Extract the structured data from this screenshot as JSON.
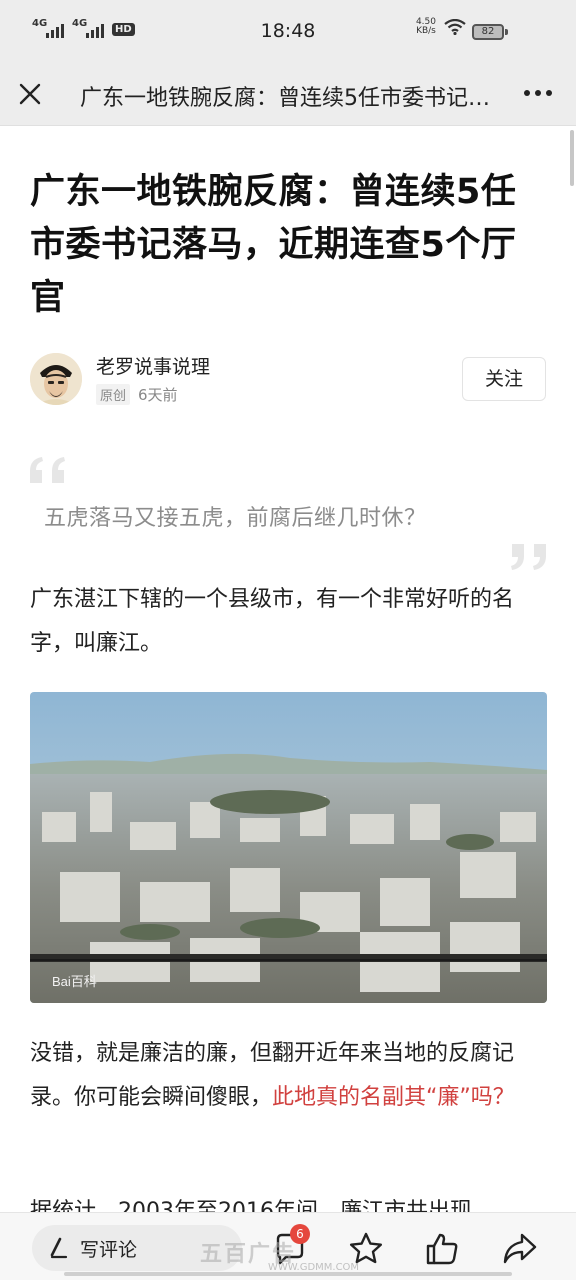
{
  "status_bar": {
    "time": "18:48",
    "network_1": "4G",
    "network_2": "4G",
    "hd_label": "HD",
    "speed_value": "4.50",
    "speed_unit": "KB/s",
    "battery": "82"
  },
  "nav": {
    "title": "广东一地铁腕反腐：曾连续5任市委书记落马，近期连查5个厅官"
  },
  "article": {
    "title": "广东一地铁腕反腐：曾连续5任市委书记落马，近期连查5个厅官",
    "author": "老罗说事说理",
    "original_tag": "原创",
    "time_ago": "6天前",
    "follow_label": "关注",
    "quote": "五虎落马又接五虎，前腐后继几时休？",
    "paragraph_1": "广东湛江下辖的一个县级市，有一个非常好听的名字，叫廉江。",
    "image_watermark": "Bai百科",
    "paragraph_2_plain": "没错，就是廉洁的廉，但翻开近年来当地的反腐记录。你可能会瞬间傻眼，",
    "paragraph_2_highlight": "此地真的名副其“廉”吗？",
    "paragraph_3": "据统计，2003年至2016年间，廉江市共出现"
  },
  "bottom_bar": {
    "comment_placeholder": "写评论",
    "comment_count": "6"
  },
  "overlay": {
    "watermark": "五百广告",
    "watermark_url": "WWW.GDMM.COM"
  },
  "colors": {
    "highlight": "#d1413f",
    "badge": "#e5473d",
    "bar_background": "#ededed"
  }
}
